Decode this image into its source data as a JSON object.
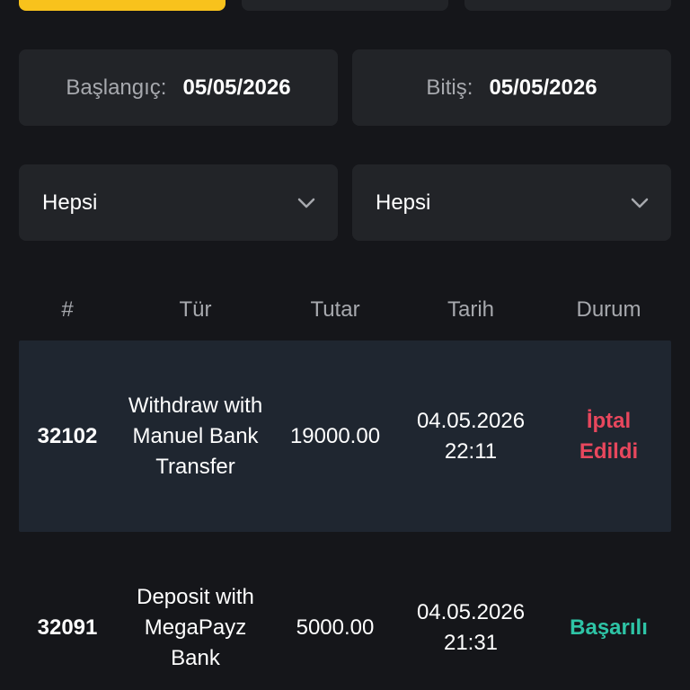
{
  "top_tabs": [
    "",
    "",
    ""
  ],
  "date_filter": {
    "start_label": "Başlangıç:",
    "start_value": "05/05/2026",
    "end_label": "Bitiş:",
    "end_value": "05/05/2026"
  },
  "filters": {
    "select1_value": "Hepsi",
    "select2_value": "Hepsi",
    "chevron_icon": "chevron-down-icon"
  },
  "table": {
    "headers": [
      "#",
      "Tür",
      "Tutar",
      "Tarih",
      "Durum"
    ],
    "rows": [
      {
        "id": "32102",
        "type": [
          "Withdraw with",
          "Manuel Bank",
          "Transfer"
        ],
        "amount": "19000.00",
        "date": [
          "04.05.2026",
          "22:11"
        ],
        "status": [
          "İptal",
          "Edildi"
        ],
        "status_color": "#e8475d"
      },
      {
        "id": "32091",
        "type": [
          "Deposit with",
          "MegaPayz",
          "Bank"
        ],
        "amount": "5000.00",
        "date": [
          "04.05.2026",
          "21:31"
        ],
        "status": [
          "Başarılı"
        ],
        "status_color": "#2ec4a6"
      }
    ]
  },
  "colors": {
    "accent": "#f8c21c",
    "background": "#15161a",
    "panel": "#222428",
    "row_highlight": "#1f2630",
    "muted_text": "#a7a9ae"
  }
}
